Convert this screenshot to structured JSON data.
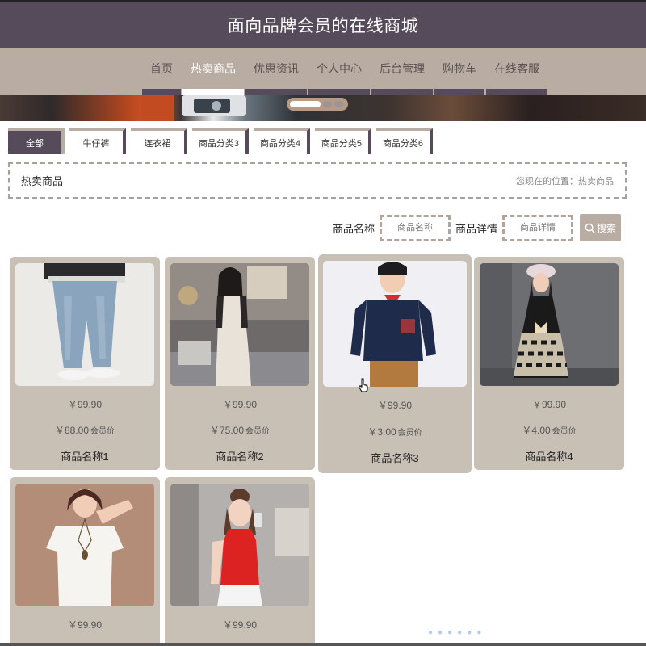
{
  "header": {
    "title": "面向品牌会员的在线商城"
  },
  "nav": {
    "items": [
      {
        "label": "首页",
        "active": false
      },
      {
        "label": "热卖商品",
        "active": true
      },
      {
        "label": "优惠资讯",
        "active": false
      },
      {
        "label": "个人中心",
        "active": false
      },
      {
        "label": "后台管理",
        "active": false
      },
      {
        "label": "购物车",
        "active": false
      },
      {
        "label": "在线客服",
        "active": false
      }
    ]
  },
  "category_tabs": [
    {
      "label": "全部",
      "active": true
    },
    {
      "label": "牛仔裤",
      "active": false
    },
    {
      "label": "连衣裙",
      "active": false
    },
    {
      "label": "商品分类3",
      "active": false
    },
    {
      "label": "商品分类4",
      "active": false
    },
    {
      "label": "商品分类5",
      "active": false
    },
    {
      "label": "商品分类6",
      "active": false
    }
  ],
  "breadcrumb": {
    "title": "热卖商品",
    "location": "您现在的位置：热卖商品"
  },
  "search": {
    "name_label": "商品名称",
    "name_placeholder": "商品名称",
    "detail_label": "商品详情",
    "detail_placeholder": "商品详情",
    "button_label": "搜索"
  },
  "products": [
    {
      "price": "￥99.90",
      "member_price": "￥88.00",
      "member_tag": "会员价",
      "name": "商品名称1"
    },
    {
      "price": "￥99.90",
      "member_price": "￥75.00",
      "member_tag": "会员价",
      "name": "商品名称2"
    },
    {
      "price": "￥99.90",
      "member_price": "￥3.00",
      "member_tag": "会员价",
      "name": "商品名称3"
    },
    {
      "price": "￥99.90",
      "member_price": "￥4.00",
      "member_tag": "会员价",
      "name": "商品名称4"
    },
    {
      "price": "￥99.90",
      "name": ""
    },
    {
      "price": "￥99.90",
      "name": ""
    }
  ],
  "colors": {
    "header": "#564b5a",
    "nav": "#b9aca2",
    "card": "#c8bfb5"
  }
}
